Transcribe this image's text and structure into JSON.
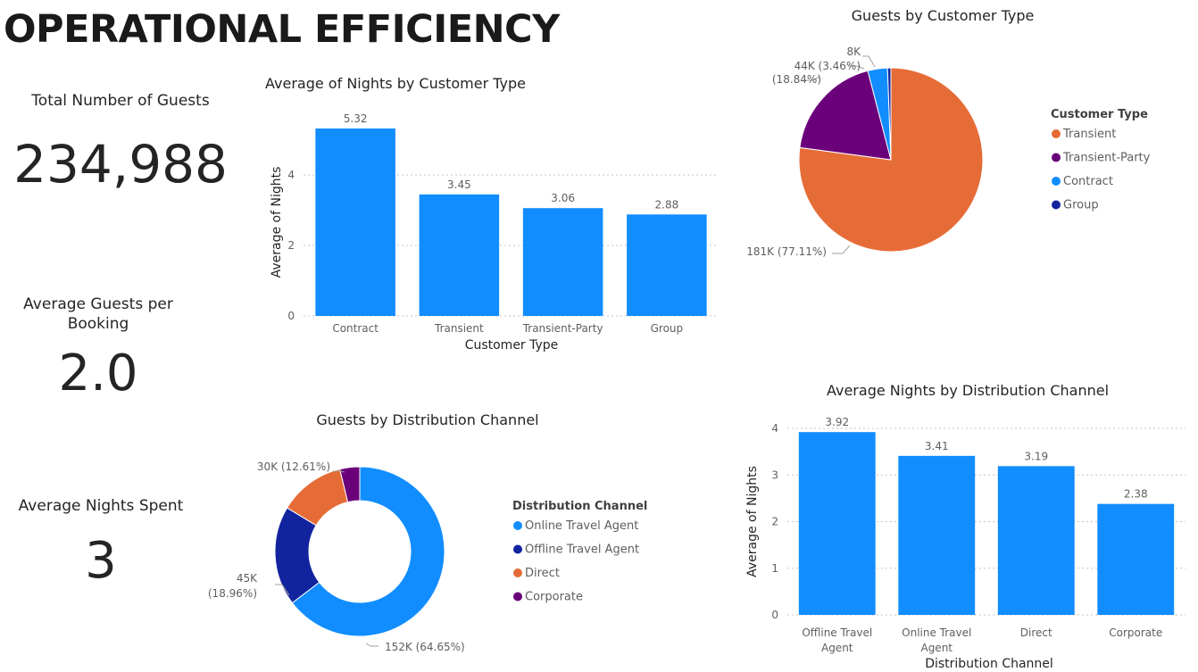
{
  "page": {
    "title": "OPERATIONAL EFFICIENCY"
  },
  "kpis": {
    "total_guests": {
      "label": "Total Number of Guests",
      "value": "234,988"
    },
    "avg_guests": {
      "label_line1": "Average Guests per",
      "label_line2": "Booking",
      "value": "2.0"
    },
    "avg_nights": {
      "label": "Average Nights Spent",
      "value": "3"
    }
  },
  "colors": {
    "bar": "#118dff",
    "transient": "#e66c37",
    "transient_party": "#6b007b",
    "contract": "#118dff",
    "group": "#12239e",
    "online": "#118dff",
    "offline": "#12239e",
    "direct": "#e66c37",
    "corporate": "#6b007b"
  },
  "chart_data": [
    {
      "id": "nights_by_customer_type",
      "type": "bar",
      "title": "Average of Nights by Customer Type",
      "xlabel": "Customer Type",
      "ylabel": "Average of Nights",
      "categories": [
        "Contract",
        "Transient",
        "Transient-Party",
        "Group"
      ],
      "values": [
        5.32,
        3.45,
        3.06,
        2.88
      ],
      "data_labels": [
        "5.32",
        "3.45",
        "3.06",
        "2.88"
      ],
      "yticks": [
        "0",
        "2",
        "4"
      ],
      "ylim": [
        0,
        5.32
      ],
      "grid": true
    },
    {
      "id": "guests_by_customer_type",
      "type": "pie",
      "title": "Guests by Customer Type",
      "legend_title": "Customer Type",
      "legend_position": "right",
      "categories": [
        "Transient",
        "Transient-Party",
        "Contract",
        "Group"
      ],
      "values": [
        77.11,
        18.84,
        3.46,
        0.59
      ],
      "data_labels": [
        "181K (77.11%)",
        "(18.84%)",
        "44K (3.46%)",
        "8K"
      ]
    },
    {
      "id": "guests_by_distribution_channel",
      "type": "pie",
      "title": "Guests by Distribution Channel",
      "legend_title": "Distribution Channel",
      "legend_position": "right",
      "categories": [
        "Online Travel Agent",
        "Offline Travel Agent",
        "Direct",
        "Corporate"
      ],
      "values": [
        64.65,
        18.96,
        12.61,
        3.78
      ],
      "data_labels": [
        "152K (64.65%)",
        "45K",
        "(18.96%)",
        "30K (12.61%)"
      ]
    },
    {
      "id": "nights_by_distribution_channel",
      "type": "bar",
      "title": "Average Nights by Distribution Channel",
      "xlabel": "Distribution Channel",
      "ylabel": "Average of Nights",
      "categories": [
        "Offline Travel Agent",
        "Online Travel Agent",
        "Direct",
        "Corporate"
      ],
      "category_lines": [
        [
          "Offline Travel",
          "Agent"
        ],
        [
          "Online Travel",
          "Agent"
        ],
        [
          "Direct"
        ],
        [
          "Corporate"
        ]
      ],
      "values": [
        3.92,
        3.41,
        3.19,
        2.38
      ],
      "data_labels": [
        "3.92",
        "3.41",
        "3.19",
        "2.38"
      ],
      "yticks": [
        "0",
        "1",
        "2",
        "3",
        "4"
      ],
      "ylim": [
        0,
        4
      ],
      "grid": true
    }
  ]
}
